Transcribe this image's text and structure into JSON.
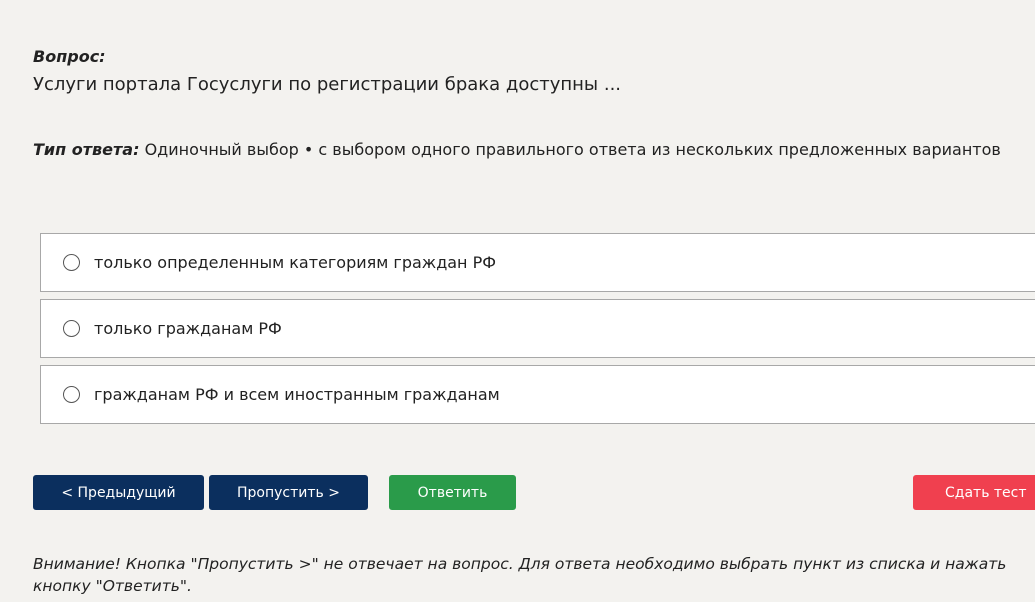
{
  "question": {
    "label": "Вопрос:",
    "text": "Услуги портала Госуслуги по регистрации брака доступны ..."
  },
  "answer_type": {
    "label": "Тип ответа:",
    "value": "Одиночный выбор • с выбором одного правильного ответа из нескольких предложенных вариантов"
  },
  "options": [
    {
      "label": "только определенным категориям граждан РФ",
      "selected": false
    },
    {
      "label": "только гражданам РФ",
      "selected": false
    },
    {
      "label": "гражданам РФ и всем иностранным гражданам",
      "selected": false
    }
  ],
  "buttons": {
    "prev": "< Предыдущий",
    "skip": "Пропустить >",
    "answer": "Ответить",
    "finish": "Сдать тест"
  },
  "colors": {
    "navy": "#0b2f5e",
    "green": "#2a9b4a",
    "red": "#f0404f"
  },
  "warning": "Внимание! Кнопка \"Пропустить >\" не отвечает на вопрос. Для ответа необходимо выбрать пункт из списка и нажать кнопку \"Ответить\"."
}
